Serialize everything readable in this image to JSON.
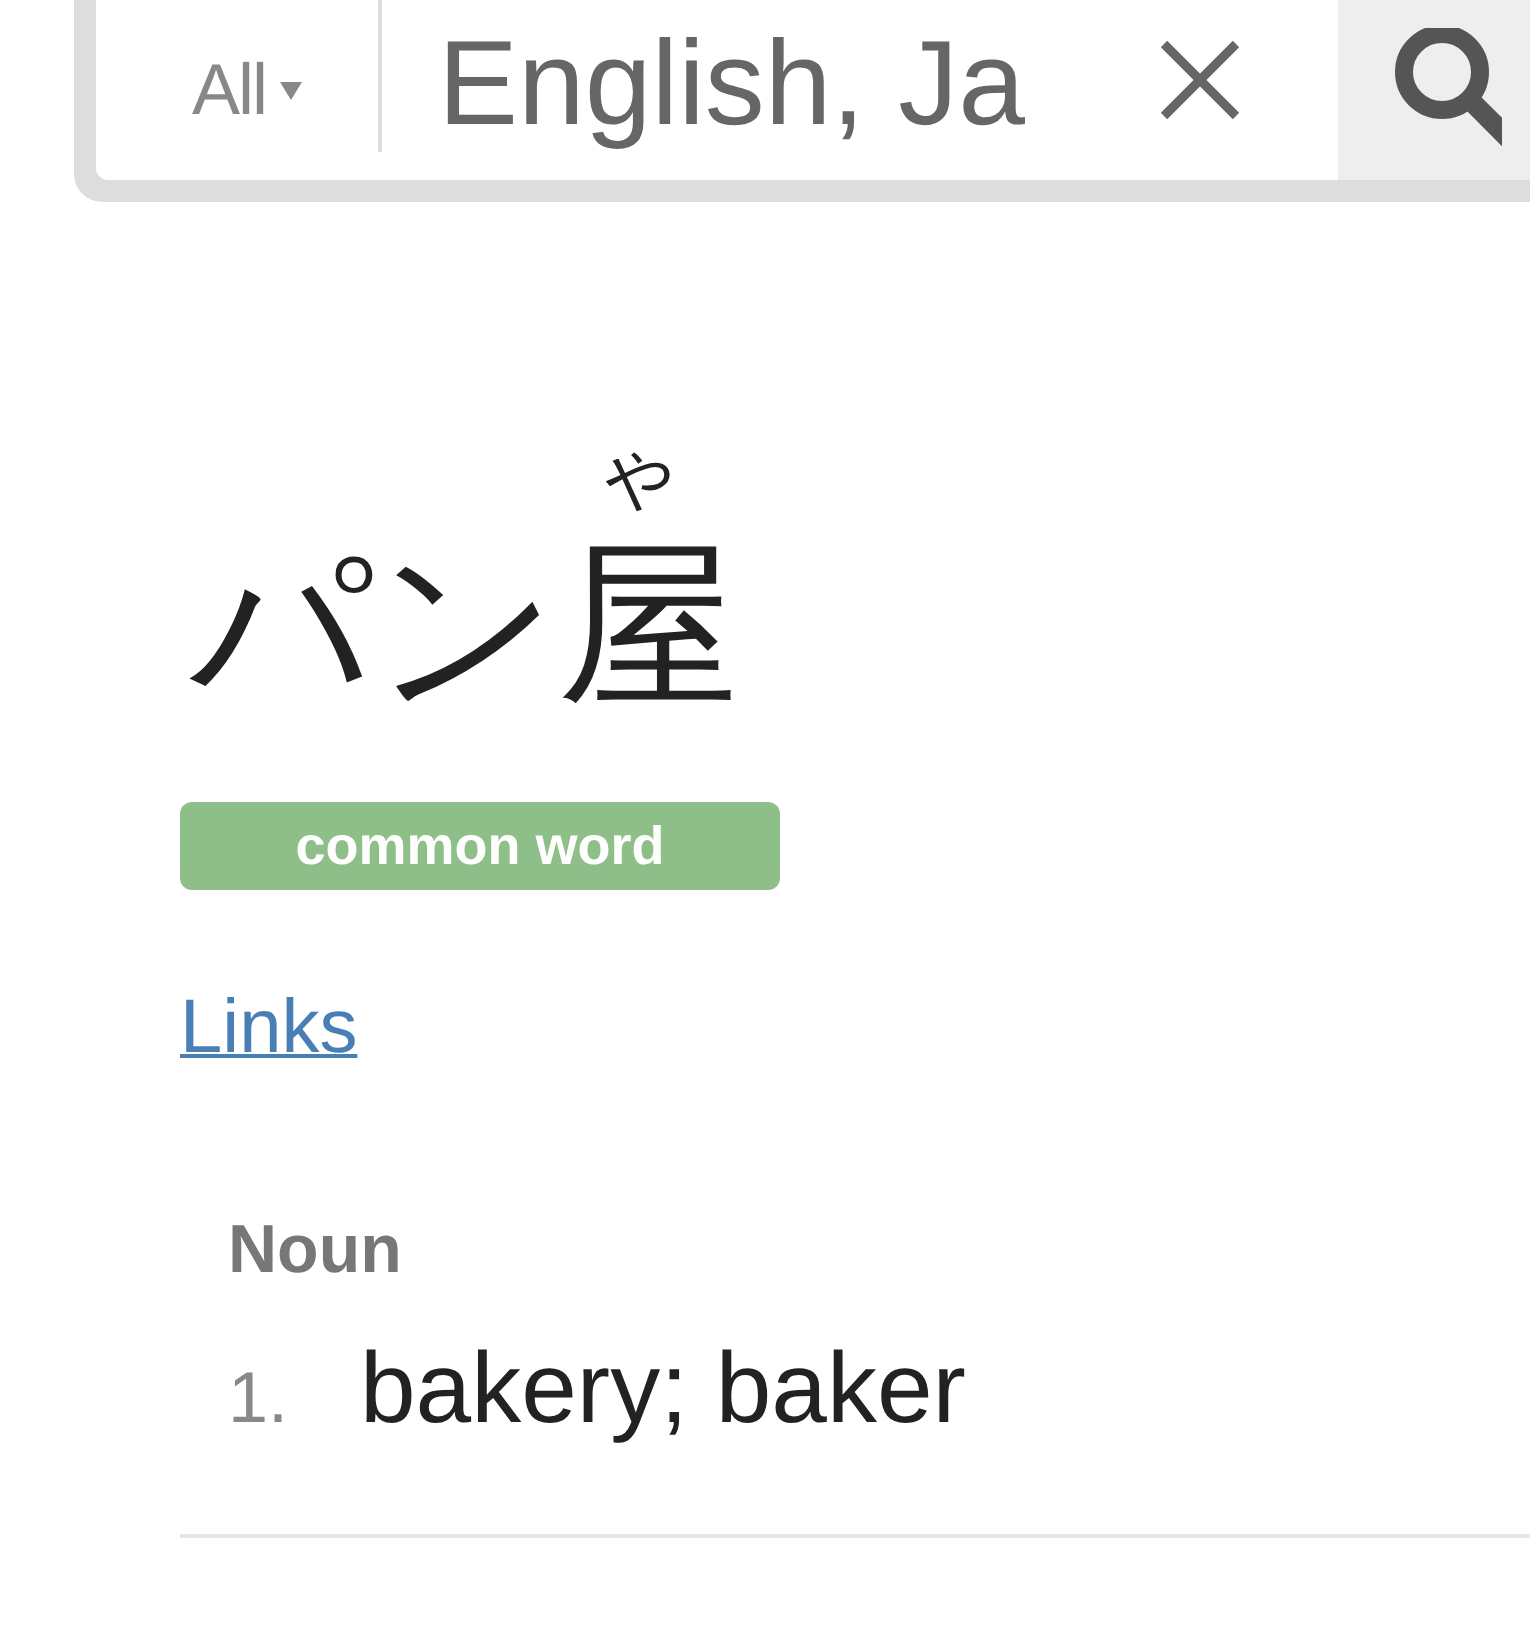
{
  "search": {
    "filter": "All",
    "query": "English, Ja"
  },
  "entry": {
    "parts": [
      {
        "text": "パン"
      },
      {
        "text": "屋",
        "reading": "や"
      }
    ],
    "tags": [
      "common word"
    ],
    "links": "Links",
    "senses": [
      {
        "pos": "Noun",
        "number": "1.",
        "meaning": "bakery; baker"
      }
    ]
  }
}
